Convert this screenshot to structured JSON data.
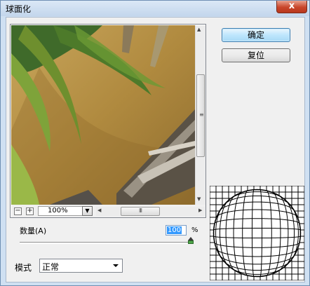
{
  "window": {
    "title": "球面化",
    "close_glyph": "x"
  },
  "buttons": {
    "ok": "确定",
    "reset": "复位"
  },
  "preview": {
    "zoom_out_glyph": "−",
    "zoom_in_glyph": "+",
    "zoom_value": "100%",
    "scroll_grip": "III"
  },
  "amount": {
    "label": "数量(A)",
    "value": "100",
    "unit": "%",
    "slider_level_percent": 100
  },
  "mode": {
    "label": "模式",
    "value": "正常"
  },
  "icons": [
    "close-icon",
    "zoom-out-icon",
    "zoom-in-icon",
    "dropdown-arrow-icon",
    "scroll-up-arrow-icon",
    "scroll-down-arrow-icon",
    "scroll-left-arrow-icon",
    "scroll-right-arrow-icon"
  ],
  "colors": {
    "title_bar": "#cfe0f2",
    "close_button": "#c8452a",
    "default_button_border": "#3c7fb1",
    "selection": "#3399ff",
    "slider_thumb": "#4ea64a"
  }
}
